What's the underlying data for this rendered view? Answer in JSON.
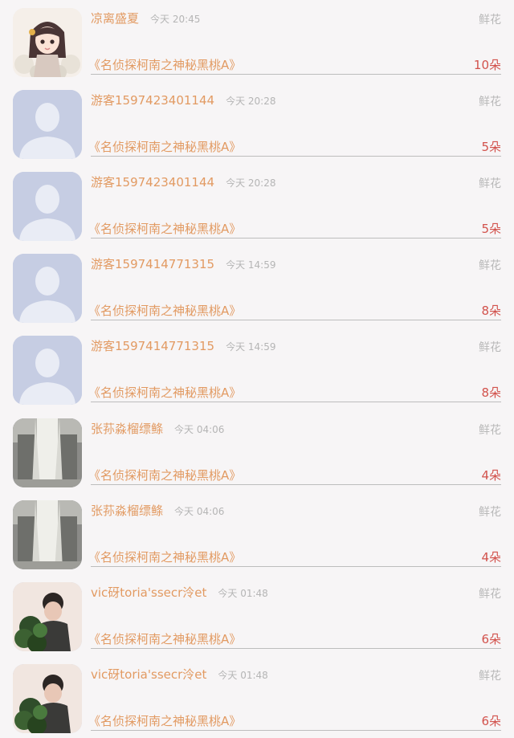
{
  "rows": [
    {
      "name": "凉离盛夏",
      "time": "今天 20:45",
      "kind": "鲜花",
      "title": "《名侦探柯南之神秘黑桃A》",
      "count": "10朵",
      "avatar": "anime-girl-avatar-icon"
    },
    {
      "name": "游客1597423401144",
      "time": "今天 20:28",
      "kind": "鲜花",
      "title": "《名侦探柯南之神秘黑桃A》",
      "count": "5朵",
      "avatar": "default-user-avatar-icon"
    },
    {
      "name": "游客1597423401144",
      "time": "今天 20:28",
      "kind": "鲜花",
      "title": "《名侦探柯南之神秘黑桃A》",
      "count": "5朵",
      "avatar": "default-user-avatar-icon"
    },
    {
      "name": "游客1597414771315",
      "time": "今天 14:59",
      "kind": "鲜花",
      "title": "《名侦探柯南之神秘黑桃A》",
      "count": "8朵",
      "avatar": "default-user-avatar-icon"
    },
    {
      "name": "游客1597414771315",
      "time": "今天 14:59",
      "kind": "鲜花",
      "title": "《名侦探柯南之神秘黑桃A》",
      "count": "8朵",
      "avatar": "default-user-avatar-icon"
    },
    {
      "name": "张荪淼榴缥鲦",
      "time": "今天 04:06",
      "kind": "鲜花",
      "title": "《名侦探柯南之神秘黑桃A》",
      "count": "4朵",
      "avatar": "window-curtain-avatar-icon"
    },
    {
      "name": "张荪淼榴缥鲦",
      "time": "今天 04:06",
      "kind": "鲜花",
      "title": "《名侦探柯南之神秘黑桃A》",
      "count": "4朵",
      "avatar": "window-curtain-avatar-icon"
    },
    {
      "name": "vic砑toria'ssecr泠et",
      "time": "今天 01:48",
      "kind": "鲜花",
      "title": "《名侦探柯南之神秘黑桃A》",
      "count": "6朵",
      "avatar": "girl-with-plant-avatar-icon"
    },
    {
      "name": "vic砑toria'ssecr泠et",
      "time": "今天 01:48",
      "kind": "鲜花",
      "title": "《名侦探柯南之神秘黑桃A》",
      "count": "6朵",
      "avatar": "girl-with-plant-avatar-icon"
    }
  ]
}
